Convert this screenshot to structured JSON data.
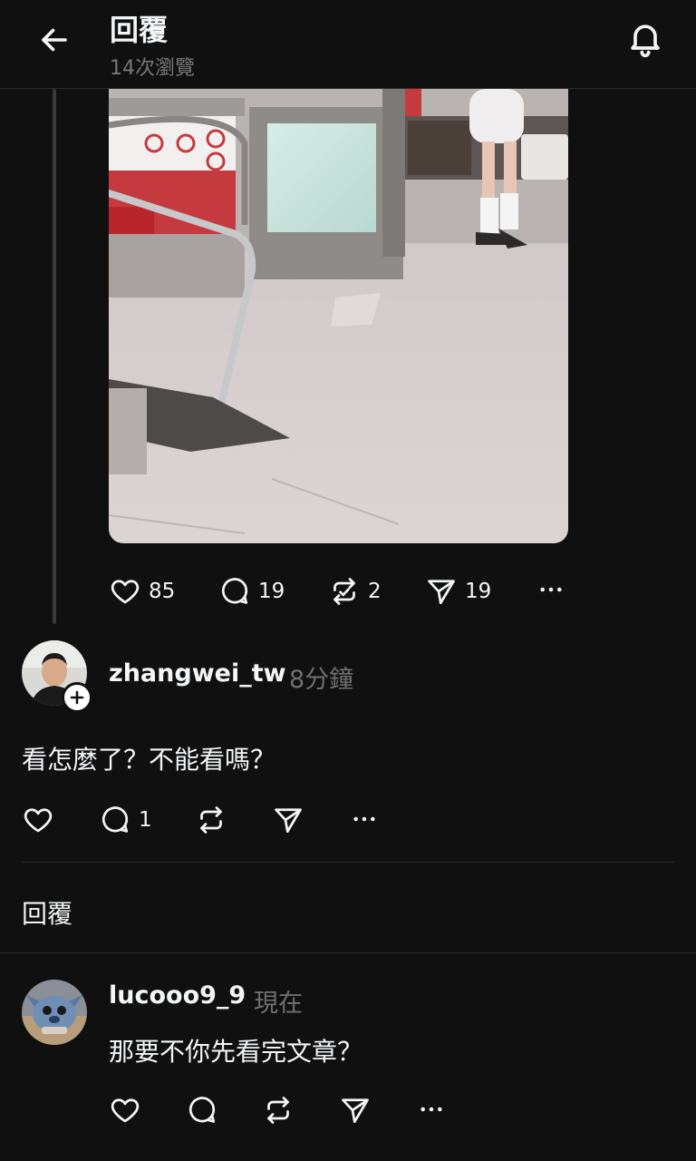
{
  "header": {
    "title": "回覆",
    "views": "14次瀏覽"
  },
  "post": {
    "likes": "85",
    "comments": "19",
    "reposts": "2",
    "shares": "19"
  },
  "reply1": {
    "username": "zhangwei_tw",
    "time": "8分鐘",
    "text": "看怎麼了？不能看嗎？",
    "comments": "1"
  },
  "section": {
    "label": "回覆"
  },
  "reply2": {
    "username": "lucooo9_9",
    "time": "現在",
    "text": "那要不你先看完文章？"
  },
  "icons": {
    "back": "arrow-left-icon",
    "notifications": "bell-icon",
    "like": "heart-icon",
    "comment": "comment-icon",
    "repost": "repost-icon",
    "share": "send-icon",
    "more": "more-icon"
  },
  "colors": {
    "background": "#101010",
    "text": "#f3f5f7",
    "muted": "#777777"
  }
}
